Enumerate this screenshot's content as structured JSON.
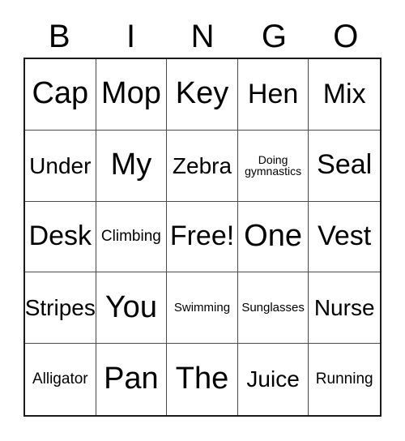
{
  "card": {
    "title": "BINGO",
    "header_letters": [
      "B",
      "I",
      "N",
      "G",
      "O"
    ],
    "grid_size": "5x5",
    "free_space_label": "Free!",
    "colors": {
      "background": "#ffffff",
      "text": "#000000",
      "grid_outer_border": "#1a1a1a",
      "grid_inner_line": "#4a4a4a"
    },
    "rows": [
      [
        {
          "text": "Cap",
          "size": "fs-xl"
        },
        {
          "text": "Mop",
          "size": "fs-xl"
        },
        {
          "text": "Key",
          "size": "fs-xl"
        },
        {
          "text": "Hen",
          "size": "fs-lg"
        },
        {
          "text": "Mix",
          "size": "fs-lg"
        }
      ],
      [
        {
          "text": "Under",
          "size": "fs-md"
        },
        {
          "text": "My",
          "size": "fs-xl"
        },
        {
          "text": "Zebra",
          "size": "fs-md"
        },
        {
          "text": "Doing\ngymnastics",
          "size": "fs-xxs"
        },
        {
          "text": "Seal",
          "size": "fs-lg"
        }
      ],
      [
        {
          "text": "Desk",
          "size": "fs-lg"
        },
        {
          "text": "Climbing",
          "size": "fs-sm"
        },
        {
          "text": "Free!",
          "size": "fs-lg"
        },
        {
          "text": "One",
          "size": "fs-xl"
        },
        {
          "text": "Vest",
          "size": "fs-lg"
        }
      ],
      [
        {
          "text": "Stripes",
          "size": "fs-md"
        },
        {
          "text": "You",
          "size": "fs-xl"
        },
        {
          "text": "Swimming",
          "size": "fs-xs"
        },
        {
          "text": "Sunglasses",
          "size": "fs-xs"
        },
        {
          "text": "Nurse",
          "size": "fs-md"
        }
      ],
      [
        {
          "text": "Alligator",
          "size": "fs-sm"
        },
        {
          "text": "Pan",
          "size": "fs-xl"
        },
        {
          "text": "The",
          "size": "fs-xl"
        },
        {
          "text": "Juice",
          "size": "fs-md"
        },
        {
          "text": "Running",
          "size": "fs-sm"
        }
      ]
    ]
  }
}
